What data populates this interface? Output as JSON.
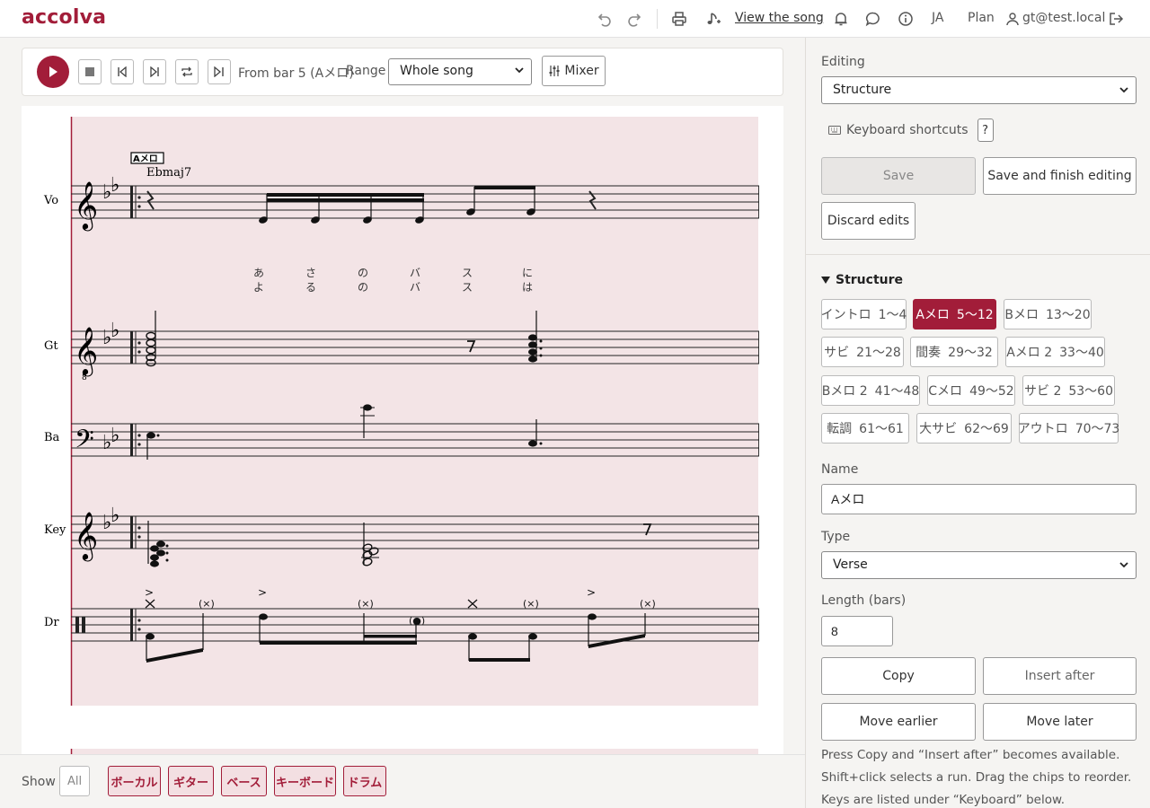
{
  "header": {
    "logo": "accolva",
    "view_song": "View the song",
    "lang": "JA",
    "plan": "Plan",
    "user_email": "gt@test.local",
    "icons": [
      "undo-icon",
      "redo-icon",
      "print-icon",
      "music-note-icon",
      "bell-icon",
      "comment-icon",
      "info-icon",
      "user-icon",
      "logout-icon"
    ]
  },
  "transport": {
    "position_text": "From bar 5 (Aメロ)",
    "range_label": "Range",
    "range_value": "Whole song",
    "mixer_label": "Mixer"
  },
  "score": {
    "section_marker": "Aメロ",
    "chord": "Ebmaj7",
    "parts": [
      "Vo",
      "Gt",
      "Ba",
      "Key",
      "Dr"
    ],
    "lyrics_line1": [
      "あ",
      "さ",
      "の",
      "バ",
      "ス",
      "に"
    ],
    "lyrics_line2": [
      "よ",
      "る",
      "の",
      "バ",
      "ス",
      "は"
    ],
    "drum_ghost": "(×)",
    "drum_ghost_note": "(●)"
  },
  "bottom": {
    "show_label": "Show",
    "all_label": "All",
    "parts": [
      "ボーカル",
      "ギター",
      "ベース",
      "キーボード",
      "ドラム"
    ]
  },
  "editor": {
    "editing_label": "Editing",
    "editing_value": "Structure",
    "kbd_shortcuts": "Keyboard shortcuts",
    "help": "?",
    "save": "Save",
    "save_finish": "Save and finish editing",
    "discard": "Discard edits",
    "structure_heading": "Structure",
    "sections": [
      {
        "name": "イントロ",
        "range": "1〜4"
      },
      {
        "name": "Aメロ",
        "range": "5〜12"
      },
      {
        "name": "Bメロ",
        "range": "13〜20"
      },
      {
        "name": "サビ",
        "range": "21〜28"
      },
      {
        "name": "間奏",
        "range": "29〜32"
      },
      {
        "name": "Aメロ 2",
        "range": "33〜40"
      },
      {
        "name": "Bメロ 2",
        "range": "41〜48"
      },
      {
        "name": "Cメロ",
        "range": "49〜52"
      },
      {
        "name": "サビ 2",
        "range": "53〜60"
      },
      {
        "name": "転調",
        "range": "61〜61"
      },
      {
        "name": "大サビ",
        "range": "62〜69"
      },
      {
        "name": "アウトロ",
        "range": "70〜73"
      }
    ],
    "active_section": 1,
    "name_label": "Name",
    "name_value": "Aメロ",
    "type_label": "Type",
    "type_value": "Verse",
    "length_label": "Length (bars)",
    "length_value": "8",
    "copy": "Copy",
    "insert_after": "Insert after",
    "move_earlier": "Move earlier",
    "move_later": "Move later",
    "help_text": "Press Copy and “Insert after” becomes available. Shift+click selects a run. Drag the chips to reorder. Keys are listed under “Keyboard” below."
  },
  "colors": {
    "accent": "#a21d39",
    "score_bg": "#f3e4e6",
    "chip_bg": "#f3dfe2"
  }
}
